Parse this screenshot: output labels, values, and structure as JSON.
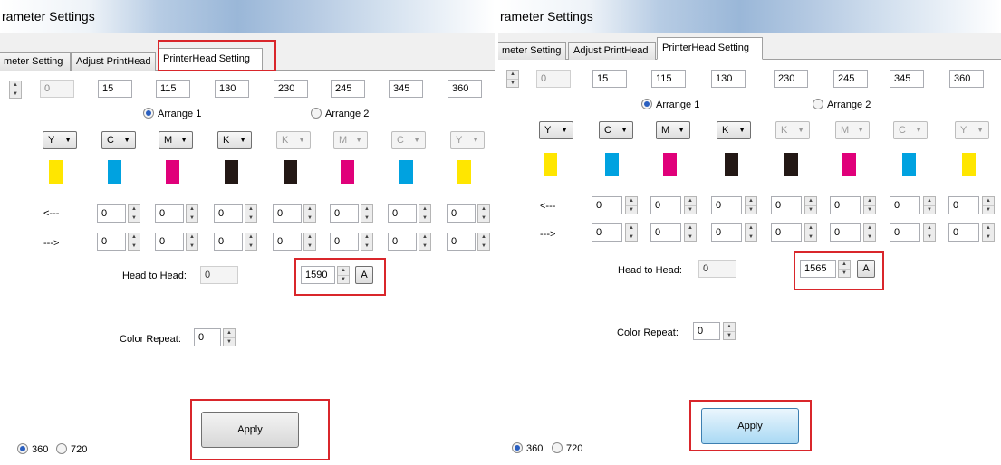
{
  "left": {
    "title": "rameter Settings",
    "tabs": [
      "meter Setting",
      "Adjust PrintHead",
      "PrinterHead Setting"
    ],
    "offsets": [
      "0",
      "15",
      "115",
      "130",
      "230",
      "245",
      "345",
      "360"
    ],
    "arrange": [
      "Arrange 1",
      "Arrange 2"
    ],
    "colors": [
      "Y",
      "C",
      "M",
      "K",
      "K",
      "M",
      "C",
      "Y"
    ],
    "swatch_colors": [
      "#ffe600",
      "#00a2e0",
      "#e0007a",
      "#231815",
      "#231815",
      "#e0007a",
      "#00a2e0",
      "#ffe600"
    ],
    "left_arrow": "<---",
    "right_arrow": "--->",
    "row_values": "0",
    "head_to_head_label": "Head to Head:",
    "head_to_head_value": "0",
    "head_value": "1590",
    "a_button": "A",
    "color_repeat_label": "Color Repeat:",
    "color_repeat_value": "0",
    "apply": "Apply",
    "dpi": [
      "360",
      "720"
    ]
  },
  "right": {
    "title": "rameter Settings",
    "tabs": [
      "meter Setting",
      "Adjust PrintHead",
      "PrinterHead Setting"
    ],
    "offsets": [
      "0",
      "15",
      "115",
      "130",
      "230",
      "245",
      "345",
      "360"
    ],
    "arrange": [
      "Arrange 1",
      "Arrange 2"
    ],
    "colors": [
      "Y",
      "C",
      "M",
      "K",
      "K",
      "M",
      "C",
      "Y"
    ],
    "swatch_colors": [
      "#ffe600",
      "#00a2e0",
      "#e0007a",
      "#231815",
      "#231815",
      "#e0007a",
      "#00a2e0",
      "#ffe600"
    ],
    "left_arrow": "<---",
    "right_arrow": "--->",
    "row_values": "0",
    "head_to_head_label": "Head to Head:",
    "head_to_head_value": "0",
    "head_value": "1565",
    "a_button": "A",
    "color_repeat_label": "Color Repeat:",
    "color_repeat_value": "0",
    "apply": "Apply",
    "dpi": [
      "360",
      "720"
    ]
  },
  "highlight_color": "#d9262b"
}
